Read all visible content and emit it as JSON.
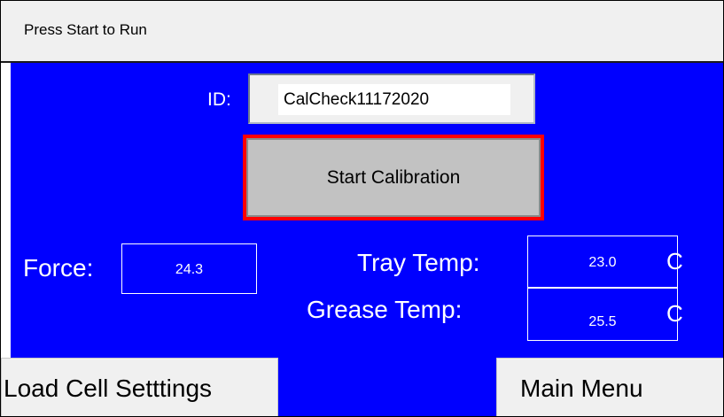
{
  "header": {
    "title": "Press Start to Run"
  },
  "id_section": {
    "label": "ID:",
    "value": "CalCheck11172020"
  },
  "start_button": {
    "label": "Start Calibration"
  },
  "force": {
    "label": "Force:",
    "value": "24.3"
  },
  "tray_temp": {
    "label": "Tray Temp:",
    "value": "23.0",
    "unit": "C"
  },
  "grease_temp": {
    "label": "Grease Temp:",
    "value": "25.5",
    "unit": "C"
  },
  "nav": {
    "load_cell_label": "Load Cell Setttings",
    "main_menu_label": "Main Menu"
  },
  "colors": {
    "panel": "#0000ff",
    "highlight_border": "#ff0000",
    "button_face": "#c2c2c2"
  }
}
